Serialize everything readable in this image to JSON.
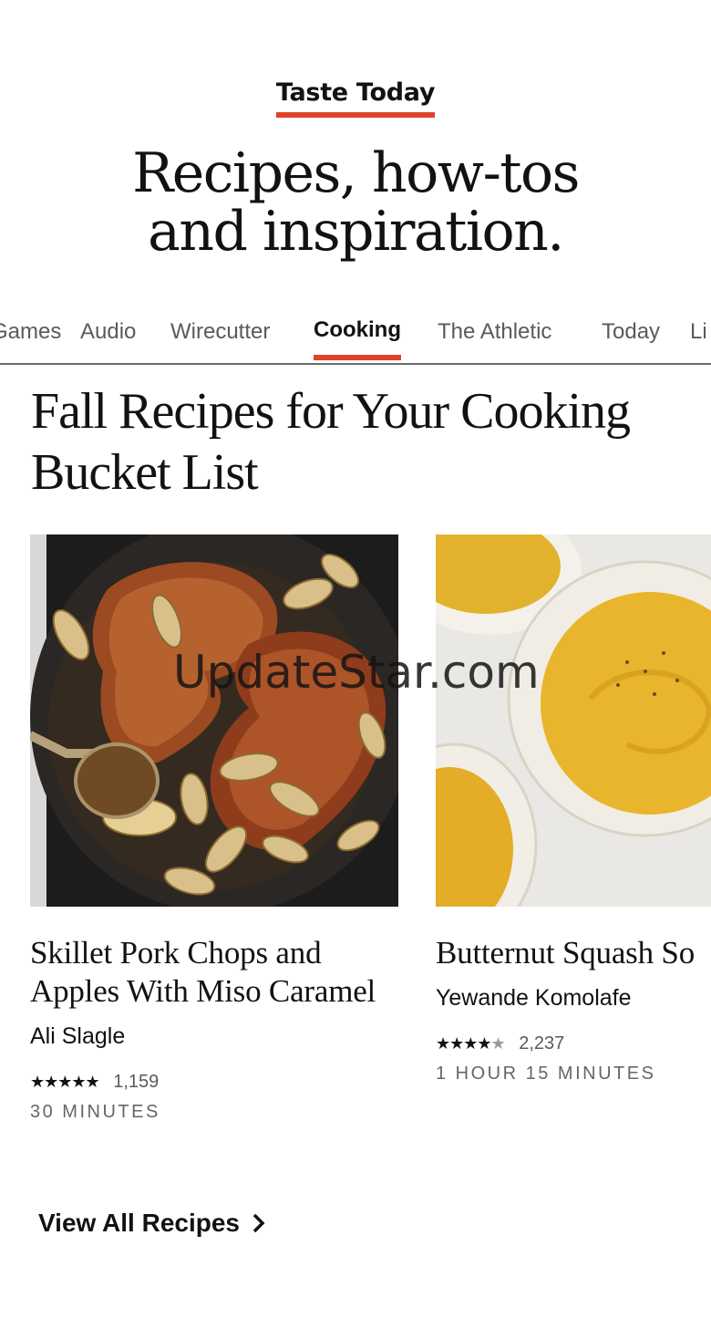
{
  "promo": {
    "eyebrow": "Taste Today",
    "headline_line1": "Recipes, how-tos",
    "headline_line2": "and inspiration."
  },
  "tabs": [
    {
      "label": "Games",
      "active": false
    },
    {
      "label": "Audio",
      "active": false
    },
    {
      "label": "Wirecutter",
      "active": false
    },
    {
      "label": "Cooking",
      "active": true
    },
    {
      "label": "The Athletic",
      "active": false
    },
    {
      "label": "Today",
      "active": false
    },
    {
      "label": "Li",
      "active": false
    }
  ],
  "section": {
    "title": "Fall Recipes for Your Cooking Bucket List"
  },
  "recipes": [
    {
      "title_line1": "Skillet Pork Chops and",
      "title_line2": "Apples With Miso Caramel",
      "author": "Ali Slagle",
      "stars": "★★★★★",
      "rating": 5,
      "rating_count": "1,159",
      "time": "30 MINUTES"
    },
    {
      "title_line1": "Butternut Squash So",
      "title_line2": "",
      "author": "Yewande Komolafe",
      "stars": "★★★★★",
      "rating": 4,
      "rating_count": "2,237",
      "time": "1 HOUR 15 MINUTES"
    }
  ],
  "footer": {
    "view_all_label": "View All Recipes"
  },
  "watermark": "UpdateStar.com",
  "colors": {
    "accent": "#e2422c",
    "text": "#121212",
    "muted": "#5a5a5a"
  }
}
